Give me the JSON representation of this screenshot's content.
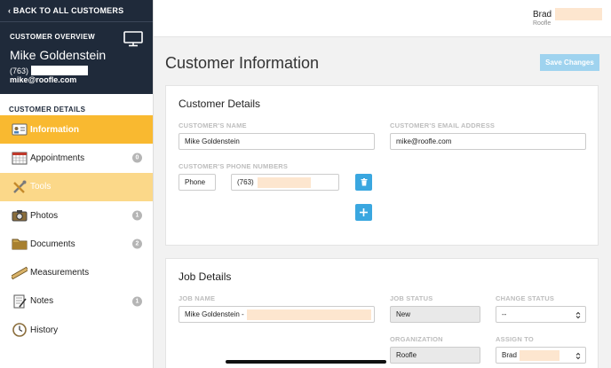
{
  "sidebar": {
    "back_label": "BACK TO ALL CUSTOMERS",
    "overview_label": "CUSTOMER OVERVIEW",
    "customer_name": "Mike Goldenstein",
    "customer_phone": "(763)",
    "customer_email": "mike@roofle.com",
    "section_label": "CUSTOMER DETAILS",
    "items": [
      {
        "label": "Information",
        "icon": "id-card-icon",
        "badge": "",
        "state": "active"
      },
      {
        "label": "Appointments",
        "icon": "calendar-icon",
        "badge": "0",
        "state": ""
      },
      {
        "label": "Tools",
        "icon": "tools-icon",
        "badge": "",
        "state": "hover"
      },
      {
        "label": "Photos",
        "icon": "camera-icon",
        "badge": "1",
        "state": ""
      },
      {
        "label": "Documents",
        "icon": "folder-icon",
        "badge": "2",
        "state": ""
      },
      {
        "label": "Measurements",
        "icon": "ruler-icon",
        "badge": "",
        "state": ""
      },
      {
        "label": "Notes",
        "icon": "notes-icon",
        "badge": "1",
        "state": ""
      },
      {
        "label": "History",
        "icon": "clock-icon",
        "badge": "",
        "state": ""
      }
    ]
  },
  "header": {
    "user_name": "Brad",
    "user_company": "Roofle"
  },
  "main": {
    "title": "Customer Information",
    "save_label": "Save Changes",
    "customer_details": {
      "title": "Customer Details",
      "name_label": "CUSTOMER'S NAME",
      "name_value": "Mike Goldenstein",
      "email_label": "CUSTOMER'S EMAIL ADDRESS",
      "email_value": "mike@roofle.com",
      "phones_label": "CUSTOMER'S PHONE NUMBERS",
      "phone_type": "Phone",
      "phone_value": "(763)"
    },
    "job_details": {
      "title": "Job Details",
      "job_name_label": "JOB NAME",
      "job_name_value": "Mike Goldenstein -",
      "job_status_label": "JOB STATUS",
      "job_status_value": "New",
      "change_status_label": "CHANGE STATUS",
      "change_status_value": "--",
      "organization_label": "ORGANIZATION",
      "organization_value": "Roofle",
      "assign_to_label": "ASSIGN TO",
      "assign_to_value": "Brad"
    }
  },
  "colors": {
    "sidebar_dark": "#1f2a3a",
    "accent_active": "#f9b930",
    "accent_hover": "#fbd889",
    "primary_button": "#3aa7e0",
    "save_button": "#9fd3ef"
  }
}
